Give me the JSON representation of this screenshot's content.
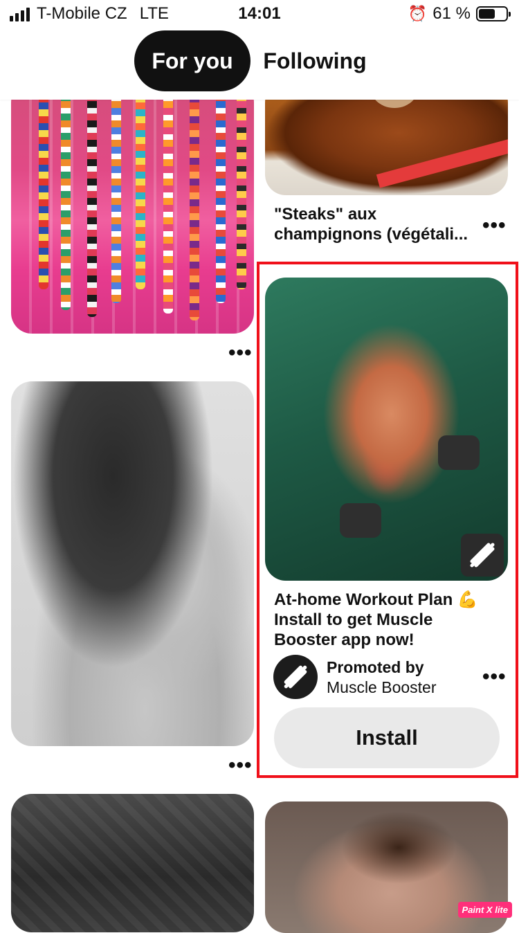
{
  "status_bar": {
    "carrier": "T-Mobile CZ",
    "network": "LTE",
    "time": "14:01",
    "battery": "61 %",
    "battery_level": 0.61
  },
  "tabs": [
    {
      "label": "For you",
      "active": true
    },
    {
      "label": "Following",
      "active": false
    }
  ],
  "pins": {
    "steak_caption": "\"Steaks\" aux champignons (végétali...",
    "more_label": "•••"
  },
  "ad": {
    "title": "At-home Workout Plan 💪 Install to get Muscle Booster app now!",
    "promoted_label": "Promoted by",
    "brand": "Muscle Booster",
    "cta": "Install",
    "highlight_color": "#f0101a"
  },
  "watermark": "Paint X lite",
  "colors": {
    "tab_active_bg": "#111111",
    "install_bg": "#e9e9e9"
  }
}
